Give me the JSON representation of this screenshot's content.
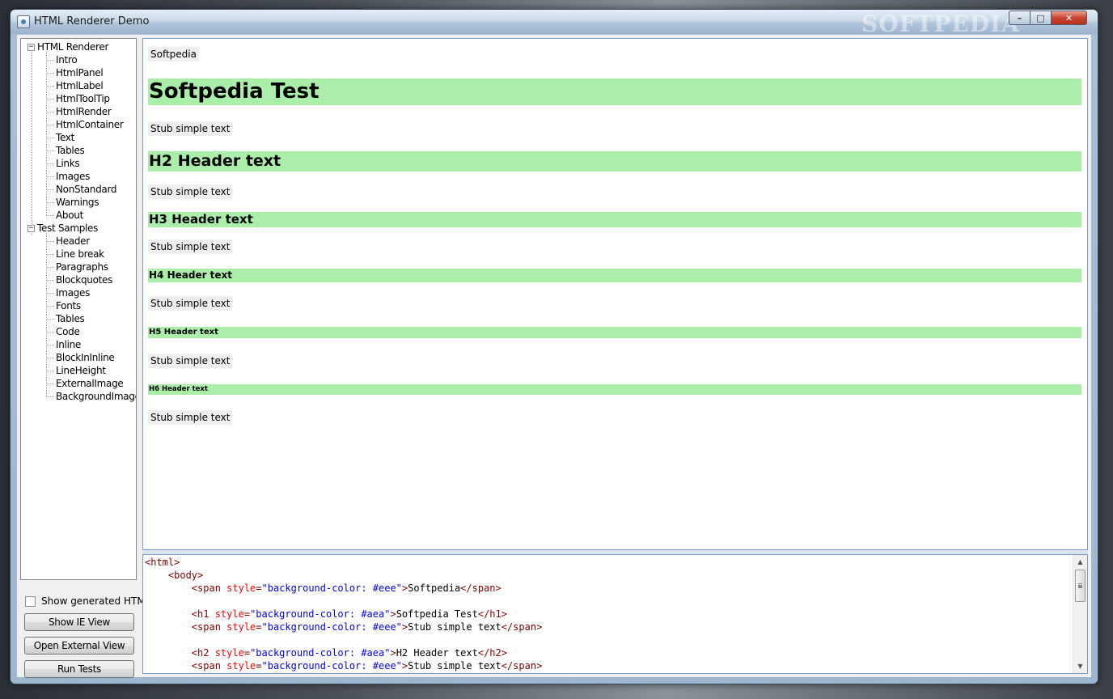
{
  "window": {
    "title": "HTML Renderer Demo",
    "watermark": "SOFTPEDIA",
    "controls": {
      "minimize": "–",
      "maximize": "□",
      "close": "✕"
    }
  },
  "tree": {
    "groups": [
      {
        "label": "HTML Renderer",
        "expander": "−",
        "items": [
          "Intro",
          "HtmlPanel",
          "HtmlLabel",
          "HtmlToolTip",
          "HtmlRender",
          "HtmlContainer",
          "Text",
          "Tables",
          "Links",
          "Images",
          "NonStandard",
          "Warnings",
          "About"
        ]
      },
      {
        "label": "Test Samples",
        "expander": "−",
        "items": [
          "Header",
          "Line break",
          "Paragraphs",
          "Blockquotes",
          "Images",
          "Fonts",
          "Tables",
          "Code",
          "Inline",
          "BlockInInline",
          "LineHeight",
          "ExternalImage",
          "BackgroundImage"
        ]
      }
    ],
    "selected": "Header"
  },
  "controls": {
    "show_generated_html": "Show generated HTML",
    "show_ie_view": "Show IE View",
    "open_external_view": "Open External View",
    "run_tests": "Run Tests"
  },
  "render": {
    "intro_span": "Softpedia",
    "h1": "Softpedia Test",
    "h2": "H2 Header text",
    "h3": "H3 Header text",
    "h4": "H4 Header text",
    "h5": "H5 Header text",
    "h6": "H6 Header text",
    "stub": "Stub simple text"
  },
  "source": {
    "lines": [
      [
        [
          "tag",
          "<html>"
        ]
      ],
      [
        [
          "tag",
          "    <body>"
        ]
      ],
      [
        [
          "tag",
          "        <span "
        ],
        [
          "attr",
          "style"
        ],
        [
          "tag",
          "="
        ],
        [
          "val",
          "\"background-color: #eee\""
        ],
        [
          "tag",
          ">"
        ],
        [
          "txt",
          "Softpedia"
        ],
        [
          "tag",
          "</span>"
        ]
      ],
      [],
      [
        [
          "tag",
          "        <h1 "
        ],
        [
          "attr",
          "style"
        ],
        [
          "tag",
          "="
        ],
        [
          "val",
          "\"background-color: #aea\""
        ],
        [
          "tag",
          ">"
        ],
        [
          "txt",
          "Softpedia Test"
        ],
        [
          "tag",
          "</h1>"
        ]
      ],
      [
        [
          "tag",
          "        <span "
        ],
        [
          "attr",
          "style"
        ],
        [
          "tag",
          "="
        ],
        [
          "val",
          "\"background-color: #eee\""
        ],
        [
          "tag",
          ">"
        ],
        [
          "txt",
          "Stub simple text"
        ],
        [
          "tag",
          "</span>"
        ]
      ],
      [],
      [
        [
          "tag",
          "        <h2 "
        ],
        [
          "attr",
          "style"
        ],
        [
          "tag",
          "="
        ],
        [
          "val",
          "\"background-color: #aea\""
        ],
        [
          "tag",
          ">"
        ],
        [
          "txt",
          "H2 Header text"
        ],
        [
          "tag",
          "</h2>"
        ]
      ],
      [
        [
          "tag",
          "        <span "
        ],
        [
          "attr",
          "style"
        ],
        [
          "tag",
          "="
        ],
        [
          "val",
          "\"background-color: #eee\""
        ],
        [
          "tag",
          ">"
        ],
        [
          "txt",
          "Stub simple text"
        ],
        [
          "tag",
          "</span>"
        ]
      ]
    ],
    "scroll_up": "▲",
    "scroll_down": "▼"
  },
  "colors": {
    "header_bg": "#aaeeaa",
    "span_bg": "#eeeeee",
    "tag": "#800000",
    "attr": "#ff0000",
    "value": "#0000ff"
  }
}
